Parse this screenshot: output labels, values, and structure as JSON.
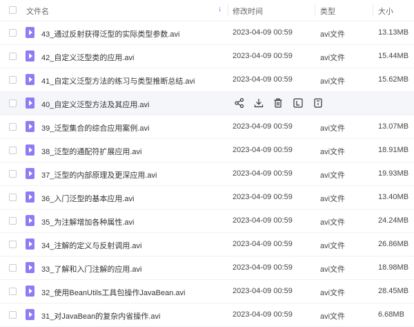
{
  "header": {
    "name": "文件名",
    "modified": "修改时间",
    "type": "类型",
    "size": "大小",
    "sort_icon": "sort-down-arrow-icon"
  },
  "colors": {
    "accent": "#2f7cf6",
    "file_icon": "#8f7cf2",
    "hover_row": "#f5f6fa"
  },
  "hover_actions": [
    "share-icon",
    "download-icon",
    "delete-icon",
    "rename-icon",
    "more-icon"
  ],
  "rows": [
    {
      "name": "43_通过反射获得泛型的实际类型参数.avi",
      "modified": "2023-04-09 00:59",
      "type": "avi文件",
      "size": "13.13MB"
    },
    {
      "name": "42_自定义泛型类的应用.avi",
      "modified": "2023-04-09 00:59",
      "type": "avi文件",
      "size": "15.44MB"
    },
    {
      "name": "41_自定义泛型方法的练习与类型推断总结.avi",
      "modified": "2023-04-09 00:59",
      "type": "avi文件",
      "size": "15.62MB"
    },
    {
      "name": "40_自定义泛型方法及其应用.avi",
      "modified": "",
      "type": "",
      "size": ""
    },
    {
      "name": "39_泛型集合的综合应用案例.avi",
      "modified": "2023-04-09 00:59",
      "type": "avi文件",
      "size": "13.07MB"
    },
    {
      "name": "38_泛型的通配符扩展应用.avi",
      "modified": "2023-04-09 00:59",
      "type": "avi文件",
      "size": "18.91MB"
    },
    {
      "name": "37_泛型的内部原理及更深应用.avi",
      "modified": "2023-04-09 00:59",
      "type": "avi文件",
      "size": "19.93MB"
    },
    {
      "name": "36_入门泛型的基本应用.avi",
      "modified": "2023-04-09 00:59",
      "type": "avi文件",
      "size": "13.40MB"
    },
    {
      "name": "35_为注解增加各种属性.avi",
      "modified": "2023-04-09 00:59",
      "type": "avi文件",
      "size": "24.24MB"
    },
    {
      "name": "34_注解的定义与反射调用.avi",
      "modified": "2023-04-09 00:59",
      "type": "avi文件",
      "size": "26.86MB"
    },
    {
      "name": "33_了解和入门注解的应用.avi",
      "modified": "2023-04-09 00:59",
      "type": "avi文件",
      "size": "18.98MB"
    },
    {
      "name": "32_使用BeanUtils工具包操作JavaBean.avi",
      "modified": "2023-04-09 00:59",
      "type": "avi文件",
      "size": "28.45MB"
    },
    {
      "name": "31_对JavaBean的复杂内省操作.avi",
      "modified": "2023-04-09 00:59",
      "type": "avi文件",
      "size": "6.68MB"
    }
  ]
}
